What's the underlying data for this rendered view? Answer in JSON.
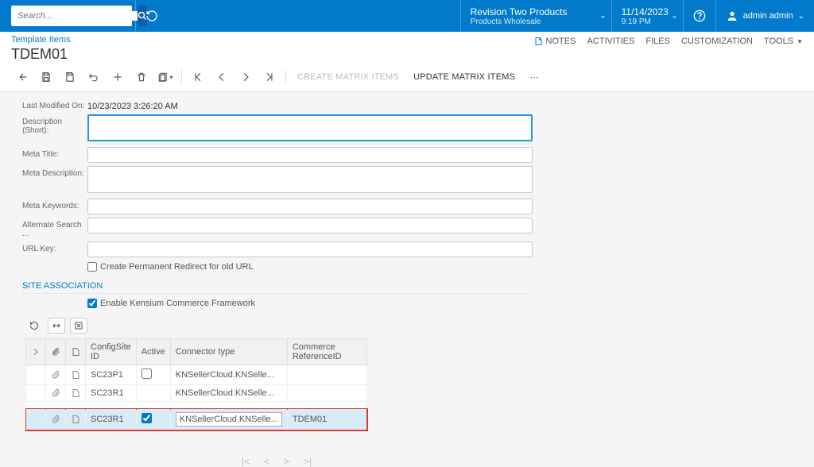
{
  "top": {
    "search_placeholder": "Search...",
    "tenant_l1": "Revision Two Products",
    "tenant_l2": "Products Wholesale",
    "date_l1": "11/14/2023",
    "date_l2": "9:19 PM",
    "user": "admin admin"
  },
  "header": {
    "breadcrumb": "Template Items",
    "title": "TDEM01",
    "actions": {
      "notes": "NOTES",
      "activities": "ACTIVITIES",
      "files": "FILES",
      "customization": "CUSTOMIZATION",
      "tools": "TOOLS"
    }
  },
  "toolbar": {
    "create_matrix": "CREATE MATRIX ITEMS",
    "update_matrix": "UPDATE MATRIX ITEMS"
  },
  "form": {
    "last_modified_lbl": "Last Modified On:",
    "last_modified_val": "10/23/2023 3:26:20 AM",
    "desc_short_lbl": "Description (Short):",
    "meta_title_lbl": "Meta Title:",
    "meta_desc_lbl": "Meta Description:",
    "meta_keywords_lbl": "Meta Keywords:",
    "alternate_lbl": "Alternate Search ...",
    "url_key_lbl": "URL Key:",
    "perm_redirect": "Create Permanent Redirect for old URL",
    "enable_kcf": "Enable Kensium Commerce Framework"
  },
  "section": {
    "site_assoc": "SITE ASSOCIATION"
  },
  "grid": {
    "cols": {
      "config": "ConfigSite ID",
      "active": "Active",
      "connector": "Connector type",
      "ref": "Commerce ReferenceID"
    },
    "rows": [
      {
        "config": "SC23P1",
        "active": false,
        "connector": "KNSellerCloud.KNSelle...",
        "ref": ""
      },
      {
        "config": "SC23R1",
        "active": false,
        "connector": "KNSellerCloud.KNSelle...",
        "ref": ""
      },
      {
        "config": "SC23R1",
        "active": true,
        "connector": "KNSellerCloud.KNSelle...",
        "ref": "TDEM01"
      }
    ]
  }
}
